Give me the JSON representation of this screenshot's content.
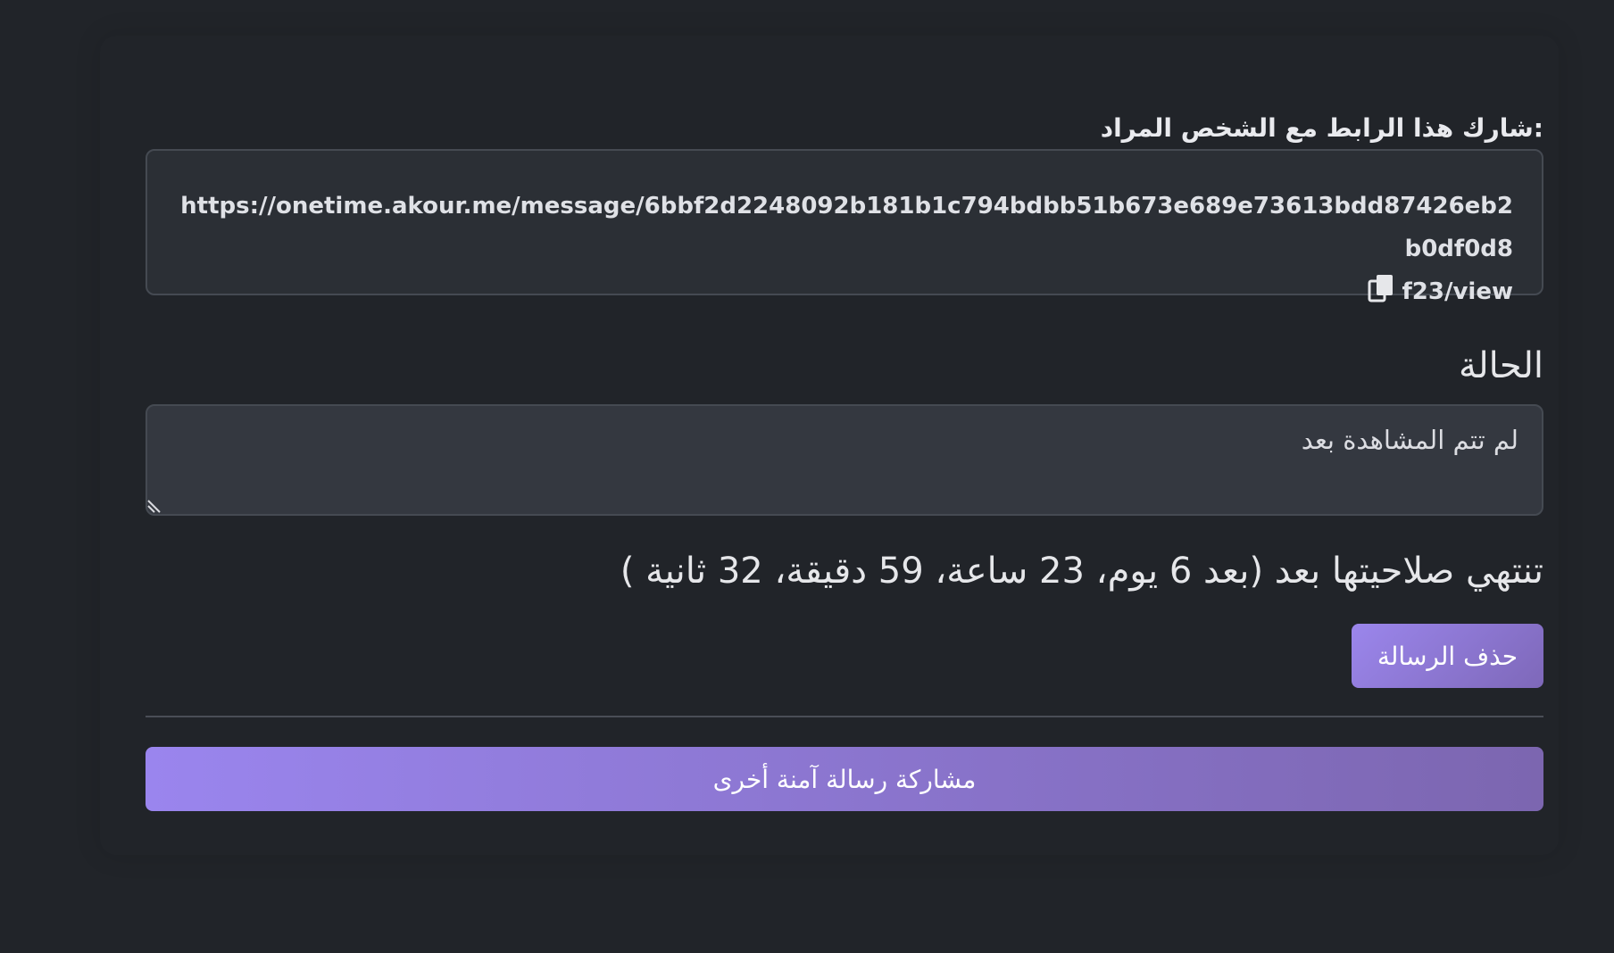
{
  "share": {
    "label": "شارك هذا الرابط مع الشخص المراد:",
    "link_line1": "https://onetime.akour.me/message/6bbf2d2248092b181b1c794bdbb51b673e689e73613bdd87426eb2b0df0d8",
    "link_line2": "f23/view",
    "copy_icon": "copy-icon"
  },
  "status": {
    "heading": "الحالة",
    "value": "لم تتم المشاهدة بعد"
  },
  "expiry": {
    "text": "تنتهي صلاحيتها بعد (بعد 6 يوم، 23 ساعة، 59 دقيقة، 32 ثانية )"
  },
  "actions": {
    "delete_label": "حذف الرسالة",
    "share_another_label": "مشاركة رسالة آمنة أخرى"
  },
  "colors": {
    "background": "#212429",
    "accent_start": "#9a85ee",
    "accent_end": "#7c66b0",
    "field_background": "#2b2f35"
  }
}
